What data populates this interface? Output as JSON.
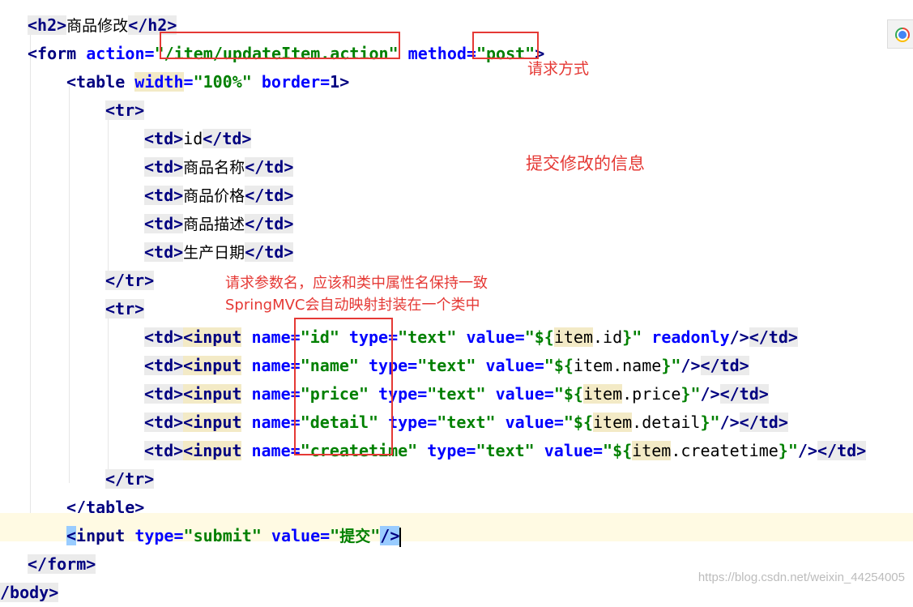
{
  "code": {
    "l1": {
      "h2_open": "<h2>",
      "h2_text": "商品修改",
      "h2_close": "</h2>"
    },
    "l2": {
      "form_open": "<form",
      "action_attr": "action",
      "eq1": "=",
      "action_q1": "\"",
      "action_value": "/item/updateItem.action",
      "action_q2": "\"",
      "method_attr": "method",
      "eq2": "=",
      "method_value": "\"post\"",
      "gt": ">"
    },
    "l3": {
      "table_open": "<table",
      "width_attr": "width",
      "eq1": "=",
      "width_value": "\"100%\"",
      "border_attr": "border",
      "eq2": "=",
      "border_value": "1",
      "gt": ">"
    },
    "l4": {
      "tr_open": "<tr>"
    },
    "header_cells": [
      {
        "td_open": "<td>",
        "text": "id",
        "td_close": "</td>"
      },
      {
        "td_open": "<td>",
        "text": "商品名称",
        "td_close": "</td>"
      },
      {
        "td_open": "<td>",
        "text": "商品价格",
        "td_close": "</td>"
      },
      {
        "td_open": "<td>",
        "text": "商品描述",
        "td_close": "</td>"
      },
      {
        "td_open": "<td>",
        "text": "生产日期",
        "td_close": "</td>"
      }
    ],
    "l10": {
      "tr_close": "</tr>"
    },
    "l11": {
      "tr_open": "<tr>"
    },
    "input_rows": [
      {
        "td_open": "<td>",
        "input": "<input",
        "name_attr": "name",
        "eq1": "=",
        "name_q1": "\"",
        "name_value": "id",
        "name_q2": "\"",
        "type_attr": "type",
        "eq2": "=",
        "type_value": "\"text\"",
        "value_attr": "value",
        "eq3": "=",
        "value_q1": "\"",
        "el_open": "${",
        "el_obj": "item",
        "el_prop": ".id",
        "el_close": "}",
        "value_q2": "\"",
        "extra": "readonly",
        "end": "/>",
        "td_close": "</td>"
      },
      {
        "td_open": "<td>",
        "input": "<input",
        "name_attr": "name",
        "eq1": "=",
        "name_q1": "\"",
        "name_value": "name",
        "name_q2": "\"",
        "type_attr": "type",
        "eq2": "=",
        "type_value": "\"text\"",
        "value_attr": "value",
        "eq3": "=",
        "value_q1": "\"",
        "el_open": "${",
        "el_obj": "item",
        "el_prop": ".name",
        "el_close": "}",
        "value_q2": "\"",
        "extra": "",
        "end": "/>",
        "td_close": "</td>"
      },
      {
        "td_open": "<td>",
        "input": "<input",
        "name_attr": "name",
        "eq1": "=",
        "name_q1": "\"",
        "name_value": "price",
        "name_q2": "\"",
        "type_attr": "type",
        "eq2": "=",
        "type_value": "\"text\"",
        "value_attr": "value",
        "eq3": "=",
        "value_q1": "\"",
        "el_open": "${",
        "el_obj": "item",
        "el_prop": ".price",
        "el_close": "}",
        "value_q2": "\"",
        "extra": "",
        "end": "/>",
        "td_close": "</td>"
      },
      {
        "td_open": "<td>",
        "input": "<input",
        "name_attr": "name",
        "eq1": "=",
        "name_q1": "\"",
        "name_value": "detail",
        "name_q2": "\"",
        "type_attr": "type",
        "eq2": "=",
        "type_value": "\"text\"",
        "value_attr": "value",
        "eq3": "=",
        "value_q1": "\"",
        "el_open": "${",
        "el_obj": "item",
        "el_prop": ".detail",
        "el_close": "}",
        "value_q2": "\"",
        "extra": "",
        "end": "/>",
        "td_close": "</td>"
      },
      {
        "td_open": "<td>",
        "input": "<input",
        "name_attr": "name",
        "eq1": "=",
        "name_q1": "\"",
        "name_value": "createtime",
        "name_q2": "\"",
        "type_attr": "type",
        "eq2": "=",
        "type_value": "\"text\"",
        "value_attr": "value",
        "eq3": "=",
        "value_q1": "\"",
        "el_open": "${",
        "el_obj": "item",
        "el_prop": ".createtime",
        "el_close": "}",
        "value_q2": "\"",
        "extra": "",
        "end": "/>",
        "td_close": "</td>"
      }
    ],
    "l17": {
      "tr_close": "</tr>"
    },
    "l18": {
      "table_close": "</table>"
    },
    "l19": {
      "lt": "<",
      "input": "input",
      "type_attr": "type",
      "eq1": "=",
      "type_value": "\"submit\"",
      "value_attr": "value",
      "eq2": "=",
      "value_q1": "\"",
      "value_text": "提交",
      "value_q2": "\"",
      "end": "/>"
    },
    "l20": {
      "form_close": "</form>"
    },
    "l21": {
      "body_close": "/body>"
    }
  },
  "annotations": {
    "method_note": "请求方式",
    "submit_note": "提交修改的信息",
    "param_note_1": "请求参数名，应该和类中属性名保持一致",
    "param_note_2": "SpringMVC会自动映射封装在一个类中"
  },
  "watermark": "https://blog.csdn.net/weixin_44254005",
  "colors": {
    "tag": "#000080",
    "attribute": "#0000ff",
    "string": "#008000",
    "annotation": "#e53935",
    "current_line": "#fffae3"
  },
  "icons": {
    "browser_preview": "chrome-icon"
  }
}
